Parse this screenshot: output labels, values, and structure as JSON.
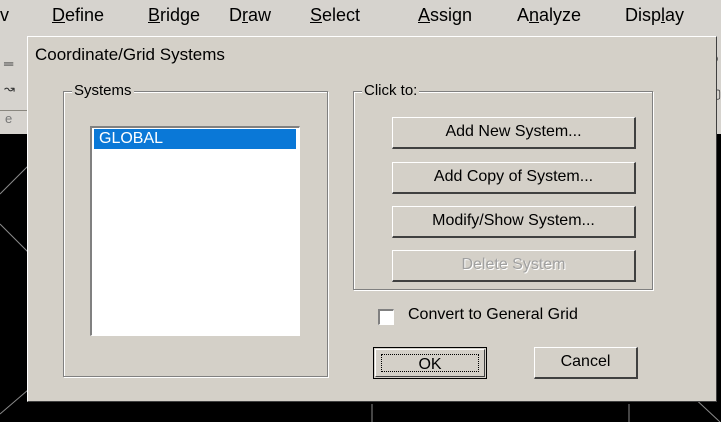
{
  "menubar": {
    "items": [
      {
        "prefix": "v",
        "accel": "",
        "rest": ""
      },
      {
        "prefix": "",
        "accel": "D",
        "rest": "efine"
      },
      {
        "prefix": "",
        "accel": "B",
        "rest": "ridge"
      },
      {
        "prefix": "D",
        "accel": "r",
        "rest": "aw"
      },
      {
        "prefix": "",
        "accel": "S",
        "rest": "elect"
      },
      {
        "prefix": "",
        "accel": "A",
        "rest": "ssign"
      },
      {
        "prefix": "A",
        "accel": "n",
        "rest": "alyze"
      },
      {
        "prefix": "Disp",
        "accel": "l",
        "rest": "ay"
      }
    ]
  },
  "dialog": {
    "title": "Coordinate/Grid Systems",
    "systems_group": {
      "label": "Systems",
      "items": [
        "GLOBAL"
      ],
      "selected": "GLOBAL"
    },
    "actions_group": {
      "label": "Click to:",
      "add_new": "Add New System...",
      "add_copy": "Add Copy of System...",
      "modify_show": "Modify/Show System...",
      "delete": "Delete System"
    },
    "convert_checkbox": {
      "label": "Convert to General Grid",
      "checked": false
    },
    "ok_label": "OK",
    "cancel_label": "Cancel"
  },
  "colors": {
    "dialog_face": "#d4d0c8",
    "selection": "#0a78d7",
    "canvas": "#000000"
  }
}
